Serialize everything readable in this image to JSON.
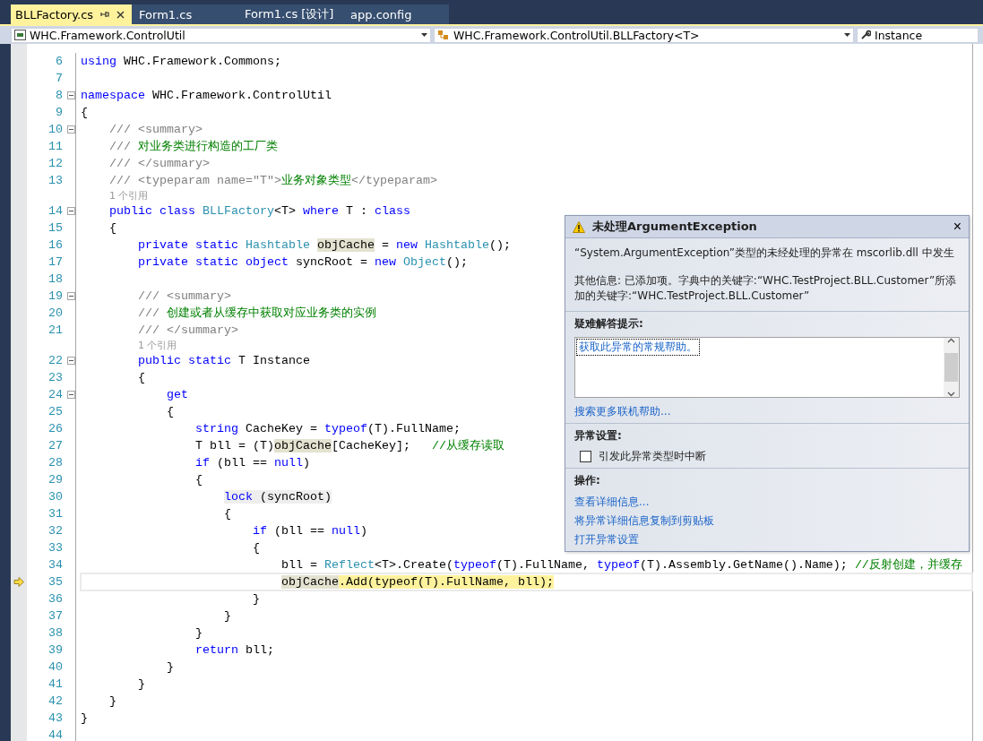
{
  "tabs": [
    {
      "label": "BLLFactory.cs",
      "selected": true,
      "pinned": true
    },
    {
      "label": "Form1.cs",
      "selected": false,
      "pinned": false
    },
    {
      "label": "Form1.cs [设计]",
      "selected": false,
      "pinned": false
    },
    {
      "label": "app.config",
      "selected": false,
      "pinned": false
    }
  ],
  "navigation": [
    {
      "kind": "project",
      "value": "WHC.Framework.ControlUtil"
    },
    {
      "kind": "class",
      "value": "WHC.Framework.ControlUtil.BLLFactory<T>"
    },
    {
      "kind": "member",
      "value": "Instance"
    }
  ],
  "lines": [
    {
      "kind": "code",
      "number": "6",
      "tokens": [
        {
          "kind": "keyword",
          "text": "using "
        },
        {
          "kind": "plain",
          "text": "WHC.Framework.Commons;"
        }
      ]
    },
    {
      "kind": "code",
      "number": "7"
    },
    {
      "kind": "code",
      "number": "8",
      "foldable": true,
      "tokens": [
        {
          "kind": "keyword",
          "text": "namespace "
        },
        {
          "kind": "plain",
          "text": "WHC.Framework.ControlUtil"
        }
      ]
    },
    {
      "kind": "code",
      "number": "9",
      "tokens": [
        {
          "kind": "plain",
          "text": "{"
        }
      ],
      "children": [
        {
          "kind": "code",
          "number": "10",
          "foldable": true,
          "tokens": [
            {
              "kind": "doc",
              "text": "/// <summary>"
            }
          ]
        },
        {
          "kind": "code",
          "number": "11",
          "tokens": [
            {
              "kind": "doc",
              "text": "/// "
            },
            {
              "kind": "doc-text",
              "text": "对业务类进行构造的工厂类"
            }
          ]
        },
        {
          "kind": "code",
          "number": "12",
          "tokens": [
            {
              "kind": "doc",
              "text": "/// </summary>"
            }
          ]
        },
        {
          "kind": "code",
          "number": "13",
          "tokens": [
            {
              "kind": "doc",
              "text": "/// <typeparam name=\"T\">"
            },
            {
              "kind": "doc-text",
              "text": "业务对象类型"
            },
            {
              "kind": "doc",
              "text": "</typeparam>"
            }
          ]
        },
        {
          "kind": "codelens",
          "text": "1 个引用"
        },
        {
          "kind": "code",
          "number": "14",
          "foldable": true,
          "tokens": [
            {
              "kind": "keyword",
              "text": "public class "
            },
            {
              "kind": "type",
              "text": "BLLFactory"
            },
            {
              "kind": "plain",
              "text": "<T> "
            },
            {
              "kind": "keyword",
              "text": "where "
            },
            {
              "kind": "plain",
              "text": "T : "
            },
            {
              "kind": "keyword",
              "text": "class"
            }
          ]
        },
        {
          "kind": "code",
          "number": "15",
          "tokens": [
            {
              "kind": "plain",
              "text": "{"
            }
          ],
          "children": [
            {
              "kind": "code",
              "number": "16",
              "tokens": [
                {
                  "kind": "keyword",
                  "text": "private static "
                },
                {
                  "kind": "type",
                  "text": "Hashtable "
                },
                {
                  "kind": "plain",
                  "text": "objCache",
                  "reference_highlight": true
                },
                {
                  "kind": "plain",
                  "text": " = "
                },
                {
                  "kind": "keyword",
                  "text": "new "
                },
                {
                  "kind": "type",
                  "text": "Hashtable"
                },
                {
                  "kind": "plain",
                  "text": "();"
                }
              ]
            },
            {
              "kind": "code",
              "number": "17",
              "tokens": [
                {
                  "kind": "keyword",
                  "text": "private static object "
                },
                {
                  "kind": "plain",
                  "text": "syncRoot = "
                },
                {
                  "kind": "keyword",
                  "text": "new "
                },
                {
                  "kind": "type",
                  "text": "Object"
                },
                {
                  "kind": "plain",
                  "text": "();"
                }
              ]
            },
            {
              "kind": "code",
              "number": "18"
            },
            {
              "kind": "code",
              "number": "19",
              "foldable": true,
              "tokens": [
                {
                  "kind": "doc",
                  "text": "/// <summary>"
                }
              ]
            },
            {
              "kind": "code",
              "number": "20",
              "tokens": [
                {
                  "kind": "doc",
                  "text": "/// "
                },
                {
                  "kind": "doc-text",
                  "text": "创建或者从缓存中获取对应业务类的实例"
                }
              ]
            },
            {
              "kind": "code",
              "number": "21",
              "tokens": [
                {
                  "kind": "doc",
                  "text": "/// </summary>"
                }
              ]
            },
            {
              "kind": "codelens",
              "text": "1 个引用"
            },
            {
              "kind": "code",
              "number": "22",
              "foldable": true,
              "tokens": [
                {
                  "kind": "keyword",
                  "text": "public static "
                },
                {
                  "kind": "plain",
                  "text": "T Instance"
                }
              ]
            },
            {
              "kind": "code",
              "number": "23",
              "tokens": [
                {
                  "kind": "plain",
                  "text": "{"
                }
              ],
              "children": [
                {
                  "kind": "code",
                  "number": "24",
                  "foldable": true,
                  "tokens": [
                    {
                      "kind": "keyword",
                      "text": "get"
                    }
                  ]
                },
                {
                  "kind": "code",
                  "number": "25",
                  "tokens": [
                    {
                      "kind": "plain",
                      "text": "{"
                    }
                  ],
                  "children": [
                    {
                      "kind": "code",
                      "number": "26",
                      "tokens": [
                        {
                          "kind": "keyword",
                          "text": "string "
                        },
                        {
                          "kind": "plain",
                          "text": "CacheKey = "
                        },
                        {
                          "kind": "keyword",
                          "text": "typeof"
                        },
                        {
                          "kind": "plain",
                          "text": "(T).FullName;"
                        }
                      ]
                    },
                    {
                      "kind": "code",
                      "number": "27",
                      "tokens": [
                        {
                          "kind": "plain",
                          "text": "T bll = (T)"
                        },
                        {
                          "kind": "plain",
                          "text": "objCache",
                          "reference_highlight": true
                        },
                        {
                          "kind": "plain",
                          "text": "[CacheKey];   "
                        },
                        {
                          "kind": "comment",
                          "text": "//从缓存读取"
                        }
                      ]
                    },
                    {
                      "kind": "code",
                      "number": "28",
                      "tokens": [
                        {
                          "kind": "keyword",
                          "text": "if "
                        },
                        {
                          "kind": "plain",
                          "text": "(bll == "
                        },
                        {
                          "kind": "keyword",
                          "text": "null"
                        },
                        {
                          "kind": "plain",
                          "text": ")"
                        }
                      ]
                    },
                    {
                      "kind": "code",
                      "number": "29",
                      "tokens": [
                        {
                          "kind": "plain",
                          "text": "{"
                        }
                      ],
                      "children": [
                        {
                          "kind": "code",
                          "number": "30",
                          "tokens": [
                            {
                              "kind": "keyword",
                              "text": "lock",
                              "scope_highlight": true
                            },
                            {
                              "kind": "plain",
                              "text": " (syncRoot)",
                              "scope_highlight": true
                            }
                          ]
                        },
                        {
                          "kind": "code",
                          "number": "31",
                          "tokens": [
                            {
                              "kind": "plain",
                              "text": "{"
                            }
                          ],
                          "children": [
                            {
                              "kind": "code",
                              "number": "32",
                              "tokens": [
                                {
                                  "kind": "keyword",
                                  "text": "if "
                                },
                                {
                                  "kind": "plain",
                                  "text": "(bll == "
                                },
                                {
                                  "kind": "keyword",
                                  "text": "null"
                                },
                                {
                                  "kind": "plain",
                                  "text": ")"
                                }
                              ]
                            },
                            {
                              "kind": "code",
                              "number": "33",
                              "tokens": [
                                {
                                  "kind": "plain",
                                  "text": "{"
                                }
                              ],
                              "children": [
                                {
                                  "kind": "code",
                                  "number": "34",
                                  "tokens": [
                                    {
                                      "kind": "plain",
                                      "text": "bll = "
                                    },
                                    {
                                      "kind": "type",
                                      "text": "Reflect"
                                    },
                                    {
                                      "kind": "plain",
                                      "text": "<T>.Create("
                                    },
                                    {
                                      "kind": "keyword",
                                      "text": "typeof"
                                    },
                                    {
                                      "kind": "plain",
                                      "text": "(T).FullName, "
                                    },
                                    {
                                      "kind": "keyword",
                                      "text": "typeof"
                                    },
                                    {
                                      "kind": "plain",
                                      "text": "(T).Assembly.GetName().Name); "
                                    },
                                    {
                                      "kind": "comment",
                                      "text": "//反射创建，并缓存"
                                    }
                                  ]
                                },
                                {
                                  "kind": "code",
                                  "number": "35",
                                  "current": true,
                                  "tokens": [
                                    {
                                      "kind": "plain",
                                      "text": "objCache",
                                      "reference_highlight": true
                                    },
                                    {
                                      "kind": "plain",
                                      "text": ".Add(typeof(T).FullName, bll);",
                                      "current_highlight": true
                                    }
                                  ]
                                }
                              ]
                            },
                            {
                              "kind": "code",
                              "number": "36",
                              "tokens": [
                                {
                                  "kind": "plain",
                                  "text": "}"
                                }
                              ]
                            }
                          ]
                        },
                        {
                          "kind": "code",
                          "number": "37",
                          "tokens": [
                            {
                              "kind": "plain",
                              "text": "}"
                            }
                          ]
                        }
                      ]
                    },
                    {
                      "kind": "code",
                      "number": "38",
                      "tokens": [
                        {
                          "kind": "plain",
                          "text": "}"
                        }
                      ]
                    },
                    {
                      "kind": "code",
                      "number": "39",
                      "tokens": [
                        {
                          "kind": "keyword",
                          "text": "return "
                        },
                        {
                          "kind": "plain",
                          "text": "bll;"
                        }
                      ]
                    }
                  ]
                },
                {
                  "kind": "code",
                  "number": "40",
                  "tokens": [
                    {
                      "kind": "plain",
                      "text": "}"
                    }
                  ]
                }
              ]
            },
            {
              "kind": "code",
              "number": "41",
              "tokens": [
                {
                  "kind": "plain",
                  "text": "}"
                }
              ]
            }
          ]
        },
        {
          "kind": "code",
          "number": "42",
          "tokens": [
            {
              "kind": "plain",
              "text": "}"
            }
          ]
        }
      ]
    },
    {
      "kind": "code",
      "number": "43",
      "tokens": [
        {
          "kind": "plain",
          "text": "}"
        }
      ]
    },
    {
      "kind": "code",
      "number": "44"
    }
  ],
  "exception": {
    "title": "未处理ArgumentException",
    "close": "×",
    "message": "“System.ArgumentException”类型的未经处理的异常在 mscorlib.dll 中发生",
    "details": "其他信息: 已添加项。字典中的关键字:“WHC.TestProject.BLL.Customer”所添加的关键字:“WHC.TestProject.BLL.Customer”",
    "tips_heading": "疑难解答提示:",
    "tips": [
      {
        "label": "获取此异常的常规帮助。",
        "selected": true
      }
    ],
    "search_link": "搜索更多联机帮助...",
    "settings_heading": "异常设置:",
    "break_option": {
      "label": "引发此异常类型时中断",
      "checked": false
    },
    "actions_heading": "操作:",
    "actions": [
      "查看详细信息...",
      "将异常详细信息复制到剪贴板",
      "打开异常设置"
    ]
  }
}
